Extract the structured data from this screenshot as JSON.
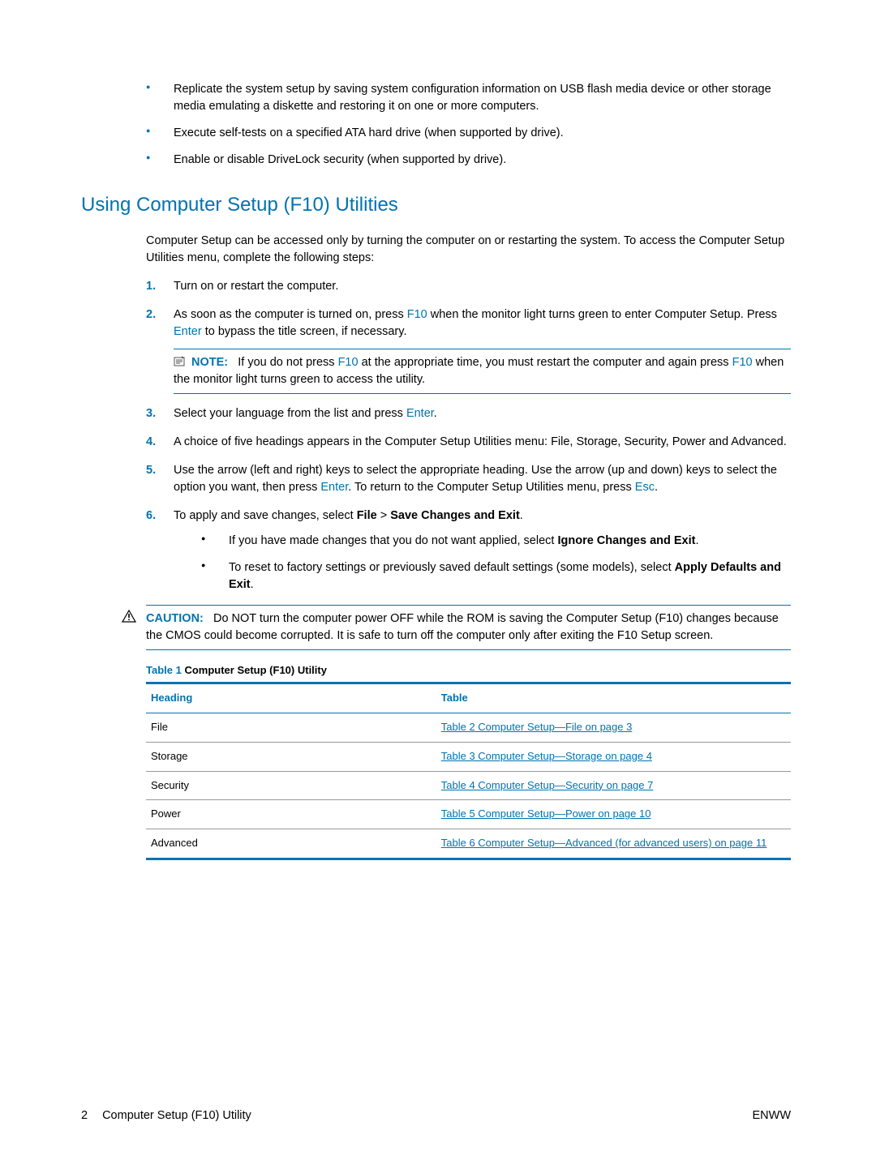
{
  "top_bullets": [
    "Replicate the system setup by saving system configuration information on USB flash media device or other storage media emulating a diskette and restoring it on one or more computers.",
    "Execute self-tests on a specified ATA hard drive (when supported by drive).",
    "Enable or disable DriveLock security (when supported by drive)."
  ],
  "heading": "Using Computer Setup (F10) Utilities",
  "intro": "Computer Setup can be accessed only by turning the computer on or restarting the system. To access the Computer Setup Utilities menu, complete the following steps:",
  "steps": {
    "s1": "Turn on or restart the computer.",
    "s2_a": "As soon as the computer is turned on, press ",
    "s2_k1": "F10",
    "s2_b": " when the monitor light turns green to enter Computer Setup. Press ",
    "s2_k2": "Enter",
    "s2_c": " to bypass the title screen, if necessary.",
    "note_label": "NOTE:",
    "note_a": "If you do not press ",
    "note_k1": "F10",
    "note_b": " at the appropriate time, you must restart the computer and again press ",
    "note_k2": "F10",
    "note_c": " when the monitor light turns green to access the utility.",
    "s3_a": "Select your language from the list and press ",
    "s3_k1": "Enter",
    "s3_b": ".",
    "s4": "A choice of five headings appears in the Computer Setup Utilities menu: File, Storage, Security, Power and Advanced.",
    "s5_a": "Use the arrow (left and right) keys to select the appropriate heading. Use the arrow (up and down) keys to select the option you want, then press ",
    "s5_k1": "Enter",
    "s5_b": ". To return to the Computer Setup Utilities menu, press ",
    "s5_k2": "Esc",
    "s5_c": ".",
    "s6_a": "To apply and save changes, select ",
    "s6_b1": "File",
    "s6_gt": " > ",
    "s6_b2": "Save Changes and Exit",
    "s6_d": ".",
    "s6_sub1_a": "If you have made changes that you do not want applied, select ",
    "s6_sub1_b": "Ignore Changes and Exit",
    "s6_sub1_c": ".",
    "s6_sub2_a": "To reset to factory settings or previously saved default settings (some models), select ",
    "s6_sub2_b": "Apply Defaults and Exit",
    "s6_sub2_c": "."
  },
  "caution": {
    "label": "CAUTION:",
    "text": "Do NOT turn the computer power OFF while the ROM is saving the Computer Setup (F10) changes because the CMOS could become corrupted. It is safe to turn off the computer only after exiting the F10 Setup screen."
  },
  "table": {
    "caption_num": "Table 1",
    "caption_title": " Computer Setup (F10) Utility",
    "headers": {
      "h1": "Heading",
      "h2": "Table"
    },
    "rows": [
      {
        "heading": "File",
        "link": "Table 2 Computer Setup—File on page 3"
      },
      {
        "heading": "Storage",
        "link": "Table 3 Computer Setup—Storage on page 4"
      },
      {
        "heading": "Security",
        "link": "Table 4 Computer Setup—Security on page 7"
      },
      {
        "heading": "Power",
        "link": "Table 5 Computer Setup—Power on page 10"
      },
      {
        "heading": "Advanced",
        "link": "Table 6 Computer Setup—Advanced (for advanced users) on page 11"
      }
    ]
  },
  "footer": {
    "page_num": "2",
    "chapter": "Computer Setup (F10) Utility",
    "right": "ENWW"
  }
}
